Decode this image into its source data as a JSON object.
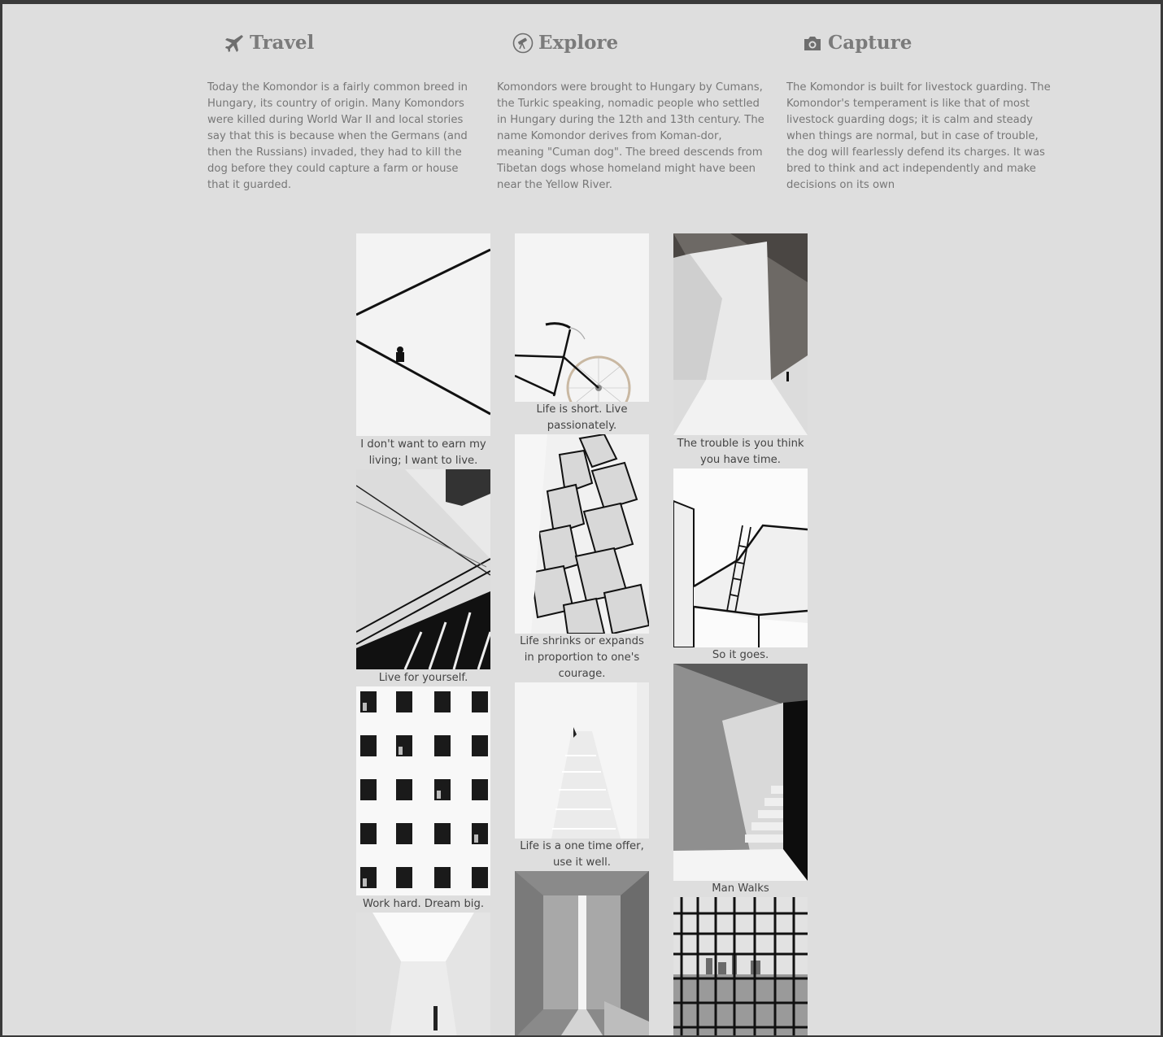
{
  "features": [
    {
      "icon": "airplane-icon",
      "title": "Travel",
      "text": "Today the Komondor is a fairly common breed in Hungary, its country of origin. Many Komondors were killed during World War II and local stories say that this is because when the Germans (and then the Russians) invaded, they had to kill the dog before they could capture a farm or house that it guarded."
    },
    {
      "icon": "telescope-icon",
      "title": "Explore",
      "text": "Komondors were brought to Hungary by Cumans, the Turkic speaking, nomadic people who settled in Hungary during the 12th and 13th century. The name Komondor derives from Koman-dor, meaning \"Cuman dog\". The breed descends from Tibetan dogs whose homeland might have been near the Yellow River."
    },
    {
      "icon": "camera-icon",
      "title": "Capture",
      "text": "The Komondor is built for livestock guarding. The Komondor's temperament is like that of most livestock guarding dogs; it is calm and steady when things are normal, but in case of trouble, the dog will fearlessly defend its charges. It was bred to think and act independently and make decisions on its own"
    }
  ],
  "gallery": {
    "col1": [
      {
        "caption": "I don't want to earn my living; I want to live.",
        "image": "stairs-diagonal-person-photo"
      },
      {
        "caption": "Live for yourself.",
        "image": "staircase-railing-photo"
      },
      {
        "caption": "Work hard. Dream big.",
        "image": "building-windows-photo"
      },
      {
        "caption": "",
        "image": "light-corridor-photo"
      }
    ],
    "col2": [
      {
        "caption": "Life is short. Live passionately.",
        "image": "bicycle-photo"
      },
      {
        "caption": "Life shrinks or expands in proportion to one's courage.",
        "image": "geometric-facade-photo"
      },
      {
        "caption": "Life is a one time offer, use it well.",
        "image": "white-stairs-photo"
      },
      {
        "caption": "",
        "image": "light-slit-photo"
      }
    ],
    "col3": [
      {
        "caption": "The trouble is you think you have time.",
        "image": "angular-room-photo"
      },
      {
        "caption": "So it goes.",
        "image": "rooftop-ladder-photo"
      },
      {
        "caption": "Man Walks",
        "image": "shadow-stairs-photo"
      },
      {
        "caption": "",
        "image": "window-grid-photo"
      }
    ]
  }
}
